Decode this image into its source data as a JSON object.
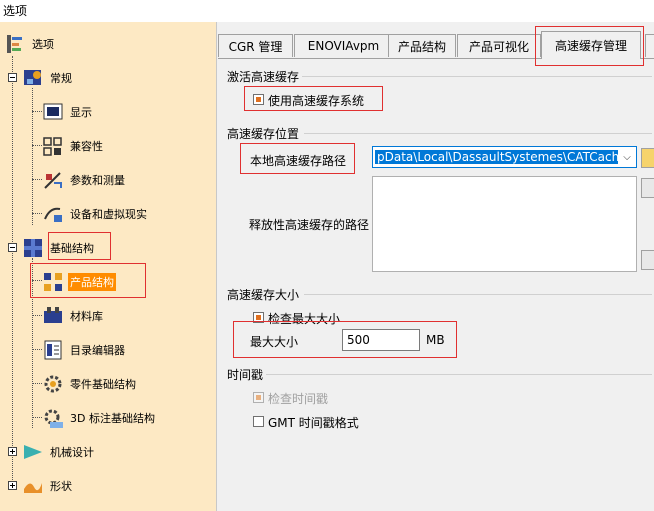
{
  "window": {
    "title": "选项"
  },
  "tree": {
    "root": "选项",
    "items": [
      {
        "label": "常规"
      },
      {
        "label": "显示"
      },
      {
        "label": "兼容性"
      },
      {
        "label": "参数和测量"
      },
      {
        "label": "设备和虚拟现实"
      },
      {
        "label": "基础结构"
      },
      {
        "label": "产品结构",
        "selected": true
      },
      {
        "label": "材料库"
      },
      {
        "label": "目录编辑器"
      },
      {
        "label": "零件基础结构"
      },
      {
        "label": "3D 标注基础结构"
      },
      {
        "label": "机械设计"
      },
      {
        "label": "形状"
      }
    ]
  },
  "tabs": [
    {
      "label": "CGR 管理"
    },
    {
      "label": "ENOVIAvpm"
    },
    {
      "label": "产品结构"
    },
    {
      "label": "产品可视化"
    },
    {
      "label": "高速缓存管理",
      "active": true
    }
  ],
  "activate": {
    "heading": "激活高速缓存",
    "use_cache_label": "使用高速缓存系统",
    "use_cache_checked": true
  },
  "location": {
    "heading": "高速缓存位置",
    "local_path_label": "本地高速缓存路径",
    "local_path_value": "pData\\Local\\DassaultSystemes\\CATCache",
    "released_path_label": "释放性高速缓存的路径"
  },
  "size": {
    "heading": "高速缓存大小",
    "check_max_label": "检查最大大小",
    "check_max_checked": true,
    "max_size_label": "最大大小",
    "max_size_value": "500",
    "unit": "MB"
  },
  "timestamp": {
    "heading": "时间戳",
    "check_time_label": "检查时间戳",
    "check_time_checked": true,
    "gmt_label": "GMT 时间戳格式",
    "gmt_checked": false
  },
  "colors": {
    "highlight": "#e03030",
    "selection": "#ff8c00",
    "tree_bg": "#fde9c4",
    "accent": "#0078d7"
  }
}
